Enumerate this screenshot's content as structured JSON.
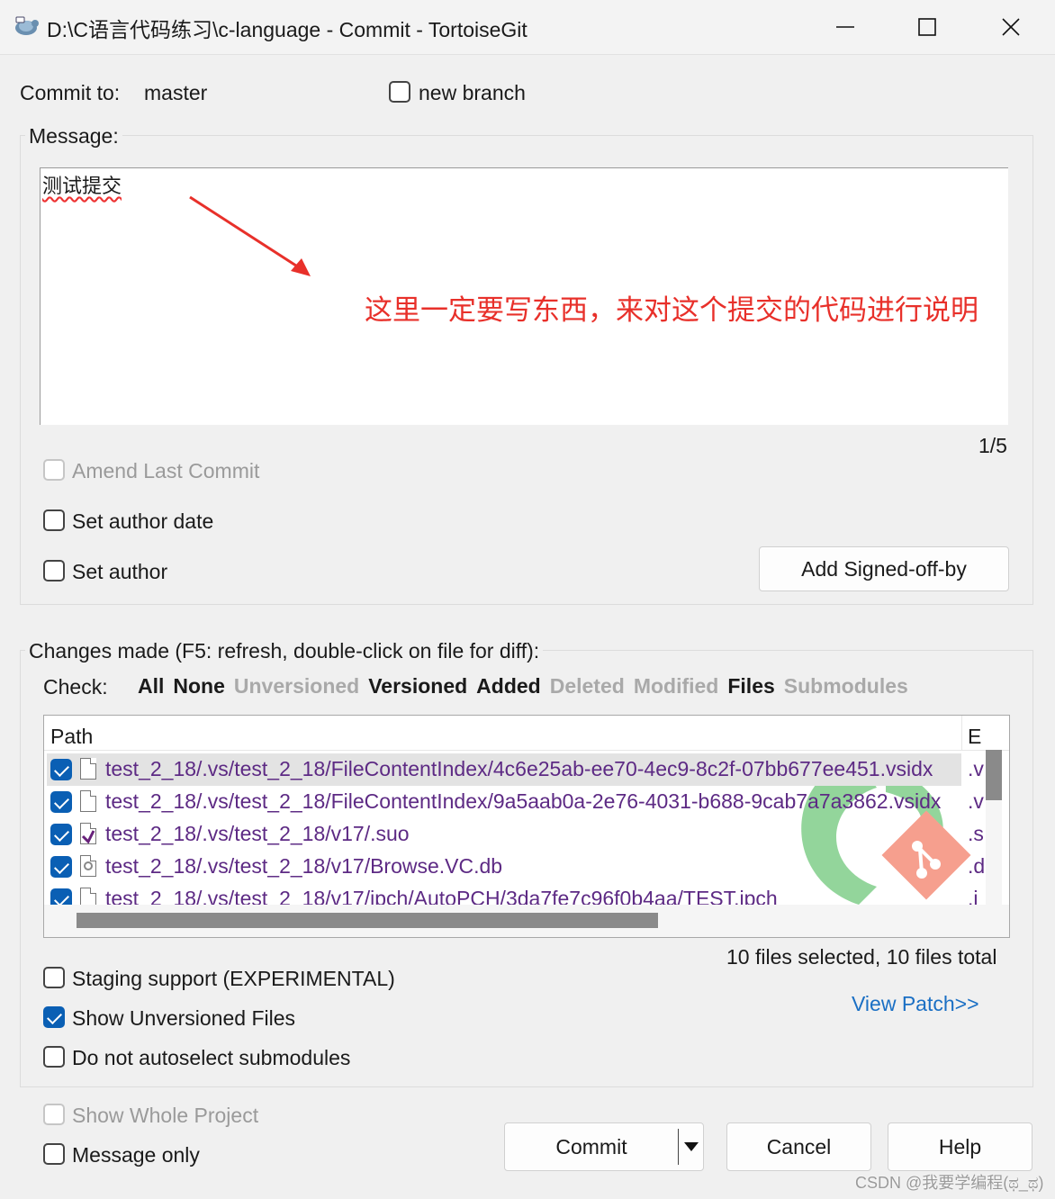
{
  "window": {
    "title": "D:\\C语言代码练习\\c-language - Commit - TortoiseGit",
    "minimize": "—",
    "maximize": "☐",
    "close": "✕"
  },
  "commit_to": {
    "label": "Commit to:",
    "branch": "master",
    "new_branch_label": "new branch",
    "new_branch_checked": false
  },
  "message": {
    "group_label": "Message:",
    "text": "测试提交",
    "annotation": "这里一定要写东西，来对这个提交的代码进行说明",
    "counter": "1/5"
  },
  "options": {
    "amend_label": "Amend Last Commit",
    "set_author_date_label": "Set author date",
    "set_author_label": "Set author",
    "signed_off_button": "Add Signed-off-by"
  },
  "changes": {
    "group_label": "Changes made (F5: refresh, double-click on file for diff):",
    "check_label": "Check:",
    "filters": [
      {
        "label": "All",
        "enabled": true
      },
      {
        "label": "None",
        "enabled": true
      },
      {
        "label": "Unversioned",
        "enabled": false
      },
      {
        "label": "Versioned",
        "enabled": true
      },
      {
        "label": "Added",
        "enabled": true
      },
      {
        "label": "Deleted",
        "enabled": false
      },
      {
        "label": "Modified",
        "enabled": false
      },
      {
        "label": "Files",
        "enabled": true
      },
      {
        "label": "Submodules",
        "enabled": false
      }
    ],
    "columns": {
      "path": "Path",
      "ext": "E"
    },
    "files": [
      {
        "path": "test_2_18/.vs/test_2_18/FileContentIndex/4c6e25ab-ee70-4ec9-8c2f-07bb677ee451.vsidx",
        "ext": ".v",
        "checked": true,
        "icon": "file-icon"
      },
      {
        "path": "test_2_18/.vs/test_2_18/FileContentIndex/9a5aab0a-2e76-4031-b688-9cab7a7a3862.vsidx",
        "ext": ".v",
        "checked": true,
        "icon": "file-icon"
      },
      {
        "path": "test_2_18/.vs/test_2_18/v17/.suo",
        "ext": ".s",
        "checked": true,
        "icon": "visual-studio-file-icon"
      },
      {
        "path": "test_2_18/.vs/test_2_18/v17/Browse.VC.db",
        "ext": ".d",
        "checked": true,
        "icon": "database-file-icon"
      },
      {
        "path": "test_2_18/.vs/test_2_18/v17/ipch/AutoPCH/3da7fe7c96f0b4aa/TEST.ipch",
        "ext": ".i",
        "checked": true,
        "icon": "file-icon"
      }
    ],
    "summary": "10 files selected, 10 files total",
    "staging_label": "Staging support (EXPERIMENTAL)",
    "show_unversioned_label": "Show Unversioned Files",
    "no_autoselect_label": "Do not autoselect submodules",
    "view_patch": "View Patch>>"
  },
  "bottom": {
    "show_whole_label": "Show Whole Project",
    "message_only_label": "Message only",
    "commit_button": "Commit",
    "cancel_button": "Cancel",
    "help_button": "Help"
  },
  "watermark": "CSDN @我要学编程(ಥ_ಥ)",
  "colors": {
    "accent": "#0a5fb4",
    "annotation": "#e8302a",
    "link": "#1a6fc4",
    "file_path": "#5d2a84"
  }
}
